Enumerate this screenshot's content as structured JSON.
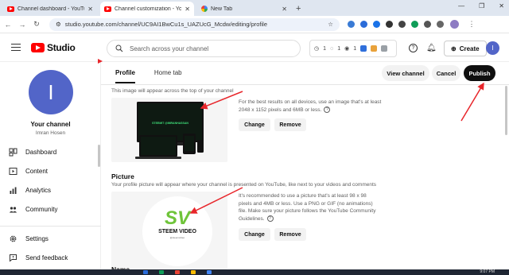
{
  "browser": {
    "tabs": [
      {
        "label": "Channel dashboard - YouTube",
        "active": false
      },
      {
        "label": "Channel customization - YouTube",
        "active": true
      },
      {
        "label": "New Tab",
        "active": false
      }
    ],
    "new_tab": "+",
    "url": "studio.youtube.com/channel/UC9AI1BwCu1s_UAZUcG_Mcdw/editing/profile"
  },
  "header": {
    "logo_text": "Studio",
    "search_placeholder": "Search across your channel",
    "tools": [
      "1",
      "1",
      "1"
    ],
    "create_label": "Create",
    "avatar_letter": "I"
  },
  "sidebar": {
    "avatar_letter": "I",
    "channel_title": "Your channel",
    "owner_name": "Imran Hosen",
    "items": [
      {
        "label": "Dashboard",
        "icon": "dashboard-icon"
      },
      {
        "label": "Content",
        "icon": "content-icon"
      },
      {
        "label": "Analytics",
        "icon": "analytics-icon"
      },
      {
        "label": "Community",
        "icon": "community-icon"
      }
    ],
    "bottom_items": [
      {
        "label": "Settings",
        "icon": "gear-icon"
      },
      {
        "label": "Send feedback",
        "icon": "feedback-icon"
      }
    ]
  },
  "main": {
    "tabs": [
      {
        "label": "Profile",
        "selected": true
      },
      {
        "label": "Home tab",
        "selected": false
      }
    ],
    "actions": {
      "view_channel": "View channel",
      "cancel": "Cancel",
      "publish": "Publish"
    },
    "banner": {
      "description": "This image will appear across the top of your channel",
      "preview_text": "STEEMIT @IMRANHASSAN",
      "help": "For the best results on all devices, use an image that's at least 2048 x 1152 pixels and 6MB or less.",
      "change": "Change",
      "remove": "Remove"
    },
    "picture": {
      "title": "Picture",
      "description": "Your profile picture will appear where your channel is presented on YouTube, like next to your videos and comments",
      "logo_letters": "SV",
      "logo_name": "STEEM VIDEO",
      "logo_sub": "@steemvideo",
      "help": "It's recommended to use a picture that's at least 98 x 98 pixels and 4MB or less. Use a PNG or GIF (no animations) file. Make sure your picture follows the YouTube Community Guidelines.",
      "change": "Change",
      "remove": "Remove"
    },
    "next_section_title": "Name"
  },
  "taskbar": {
    "time": "9:07 PM"
  },
  "colors": {
    "brand_red": "#ff0000",
    "avatar_blue": "#5265c8",
    "annotation_red": "#e8262b",
    "publish_bg": "#0f0f0f"
  }
}
